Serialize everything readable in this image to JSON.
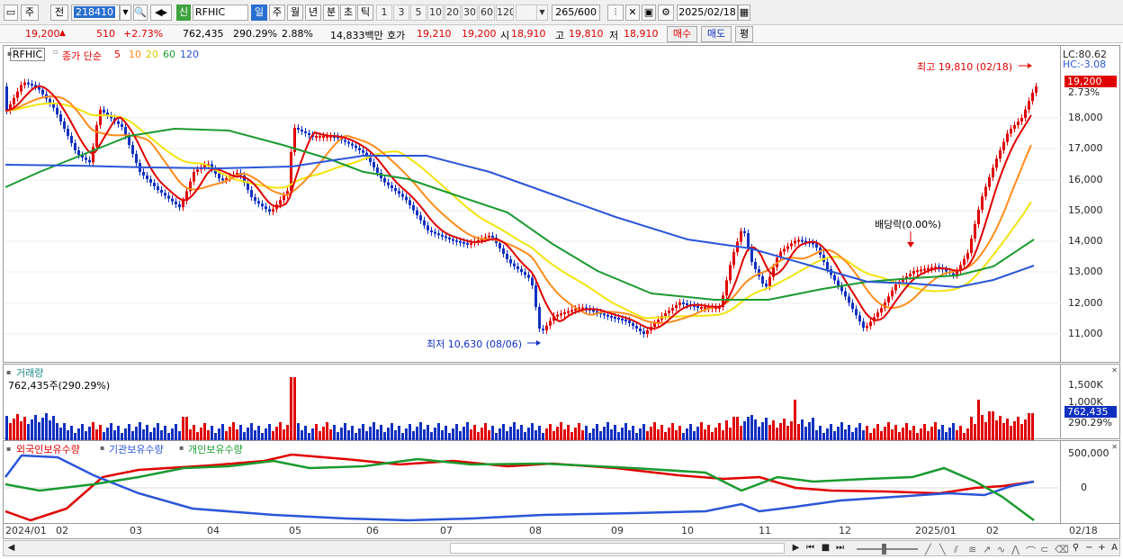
{
  "toolbar": {
    "mode": "주",
    "prev": "전",
    "code": "218410",
    "new_badge": "신",
    "name": "RFHIC",
    "periods": [
      "일",
      "주",
      "월",
      "년",
      "분",
      "초",
      "틱"
    ],
    "intervals": [
      "1",
      "3",
      "5",
      "10",
      "20",
      "30",
      "60",
      "120"
    ],
    "count": "265",
    "count_total": "/600",
    "date": "2025/02/18"
  },
  "info": {
    "price": "19,200",
    "change": "510",
    "change_pct": "+2.73%",
    "volume": "762,435",
    "volume_pct": "290.29%",
    "turnover": "2.88%",
    "amount": "14,833백만",
    "quote_label": "호가",
    "ask": "19,210",
    "bid": "19,200",
    "open_label": "시",
    "open": "18,910",
    "high_label": "고",
    "high": "19,810",
    "low_label": "저",
    "low": "18,910",
    "buy": "매수",
    "sell": "매도",
    "eval": "평"
  },
  "price_panel": {
    "ticker_box": "RFHIC",
    "ma_label": "종가 단순",
    "ma_periods": [
      "5",
      "10",
      "20",
      "60",
      "120"
    ],
    "lc": "LC:80.62",
    "hc": "HC:-3.08",
    "current": "19,200",
    "current_pct": "2.73%",
    "high_note": "최고 19,810 (02/18)",
    "low_note": "최저 10,630 (08/06)",
    "dividend_note": "배당락(0.00%)",
    "yticks": [
      "18,000",
      "17,000",
      "16,000",
      "15,000",
      "14,000",
      "13,000",
      "12,000",
      "11,000"
    ]
  },
  "volume_panel": {
    "title": "거래량",
    "subtitle": "762,435주(290.29%)",
    "yticks": [
      "1,500K",
      "1,000K"
    ],
    "current": "762,435",
    "current_pct": "290.29%"
  },
  "holding_panel": {
    "legend": [
      "외국인보유수량",
      "기관보유수량",
      "개인보유수량"
    ],
    "yticks": [
      "500,000",
      "0"
    ]
  },
  "xaxis": [
    "2024/01",
    "02",
    "03",
    "04",
    "05",
    "06",
    "07",
    "08",
    "09",
    "10",
    "11",
    "12",
    "2025/01",
    "02",
    "02/18"
  ],
  "colors": {
    "ma5": "#e00000",
    "ma10": "#ff8c1a",
    "ma20": "#f2e40b",
    "ma60": "#1a9a30",
    "ma120": "#2a55d8",
    "up": "#e00000",
    "down": "#1030c0"
  }
}
